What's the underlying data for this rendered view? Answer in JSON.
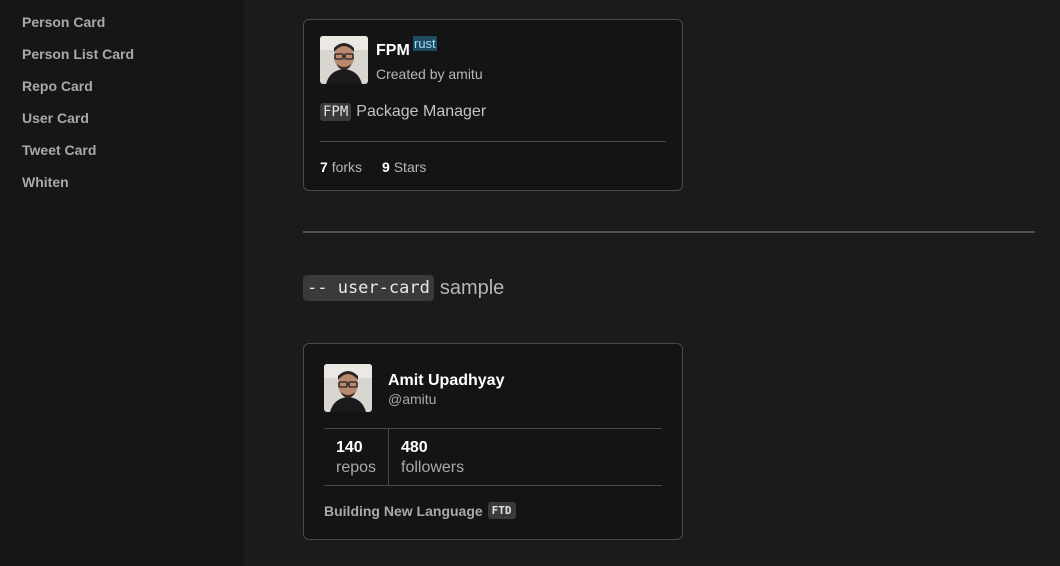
{
  "sidebar": {
    "items": [
      {
        "label": "Person Card"
      },
      {
        "label": "Person List Card"
      },
      {
        "label": "Repo Card"
      },
      {
        "label": "User Card"
      },
      {
        "label": "Tweet Card"
      },
      {
        "label": "Whiten"
      }
    ]
  },
  "repo_card": {
    "name": "FPM",
    "language": "rust",
    "author": "Created by amitu",
    "description_code": "FPM",
    "description_text": "Package Manager",
    "forks_count": "7",
    "forks_label": "forks",
    "stars_count": "9",
    "stars_label": "Stars"
  },
  "section": {
    "code": "-- user-card",
    "text": "sample"
  },
  "user_card": {
    "name": "Amit Upadhyay",
    "handle": "@amitu",
    "repos_count": "140",
    "repos_label": "repos",
    "followers_count": "480",
    "followers_label": "followers",
    "bio_text": "Building New Language",
    "bio_code": "FTD"
  }
}
